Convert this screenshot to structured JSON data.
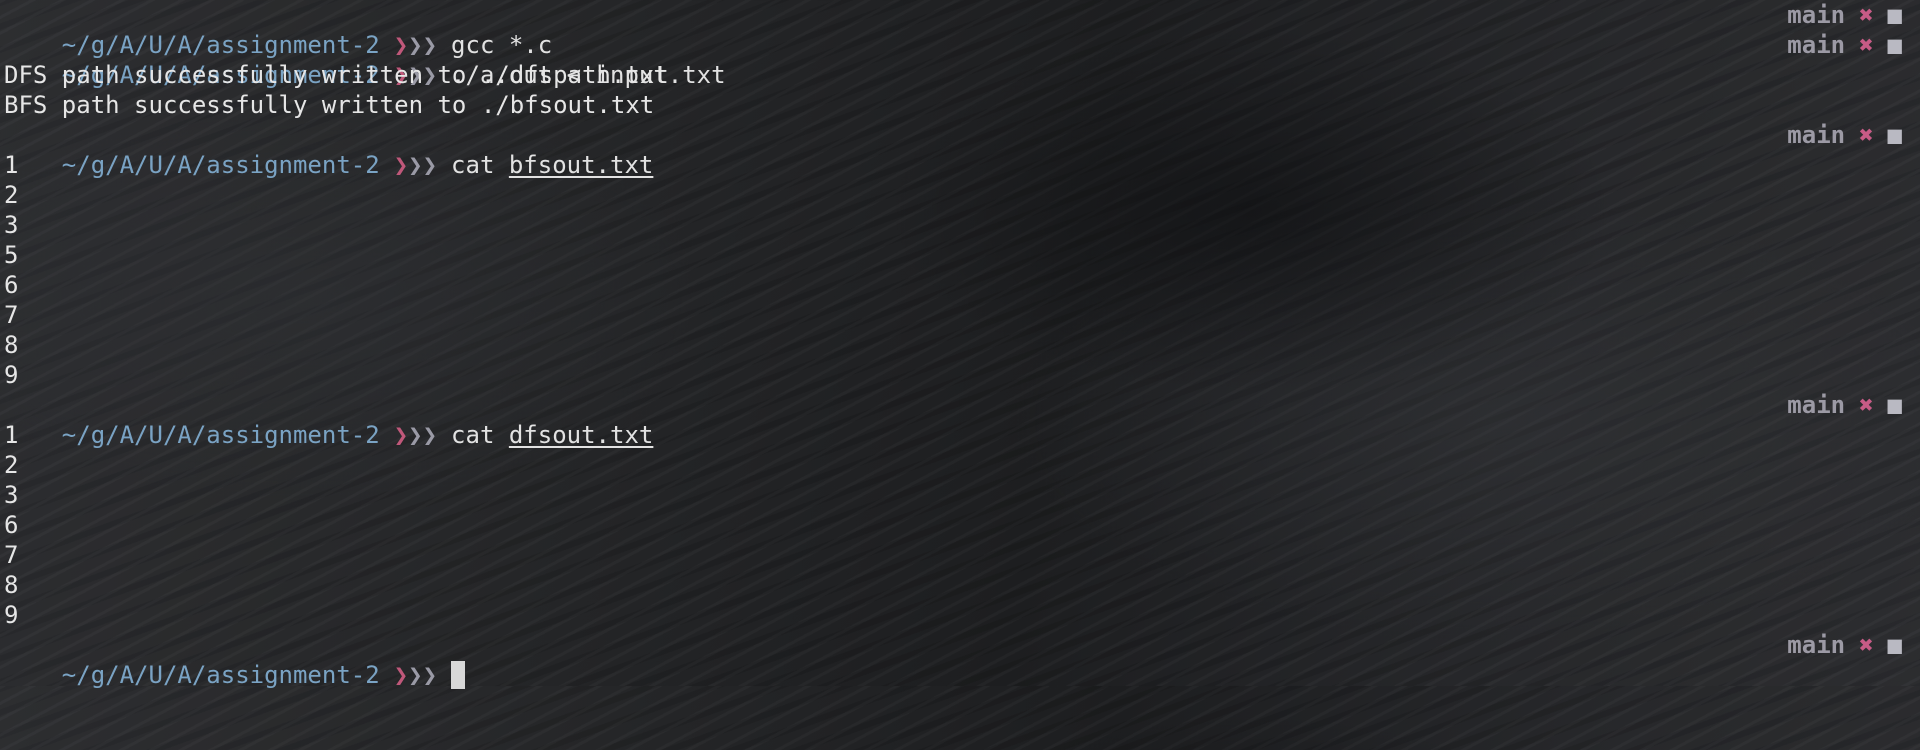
{
  "prompt": {
    "dir": "~/g/A/U/A/assignment-2",
    "chevron_first": "❯",
    "chevron_rest": "❯❯"
  },
  "rprompt": {
    "branch": "main",
    "dirty_mark": "✖",
    "status_mark": "■"
  },
  "session": {
    "cmd1": "gcc *.c",
    "cmd2": "./a.out < input.txt",
    "out_dfs": "DFS path successfully written to ./dfspath.txt",
    "out_bfs": "BFS path successfully written to ./bfsout.txt",
    "cmd3_verb": "cat",
    "cmd3_file": "bfsout.txt",
    "bfs_lines": [
      "1",
      "2",
      "3",
      "5",
      "6",
      "7",
      "8",
      "9"
    ],
    "cmd4_verb": "cat",
    "cmd4_file": "dfsout.txt",
    "dfs_lines": [
      "1",
      "2",
      "3",
      "6",
      "7",
      "8",
      "9"
    ]
  },
  "colors": {
    "dir": "#7aa3c4",
    "chevron_accent": "#c0587a",
    "dirty": "#c75b86",
    "branch": "#9c9aa5"
  }
}
